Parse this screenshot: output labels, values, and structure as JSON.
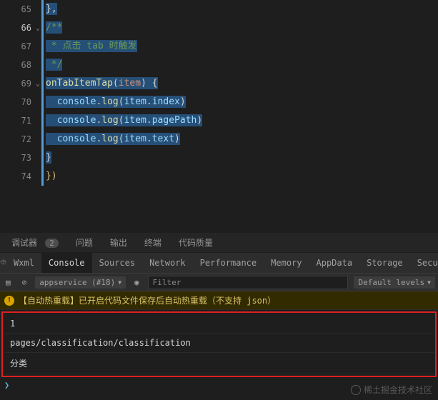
{
  "lines": [
    {
      "n": "65",
      "frag": [
        [
          "c-p",
          "},"
        ]
      ]
    },
    {
      "n": "66",
      "active": true,
      "fold": true,
      "frag": [
        [
          "c-c",
          "/**"
        ]
      ]
    },
    {
      "n": "67",
      "frag": [
        [
          "c-c",
          " * 点击 tab 时触发"
        ]
      ]
    },
    {
      "n": "68",
      "frag": [
        [
          "c-c",
          " */"
        ]
      ]
    },
    {
      "n": "69",
      "fold": true,
      "frag": [
        [
          "c-g",
          "onTabItemTap"
        ],
        [
          "c-p",
          "("
        ],
        [
          "c-o",
          "item"
        ],
        [
          "c-p",
          ") {"
        ]
      ]
    },
    {
      "n": "70",
      "frag": [
        [
          "c-b",
          "  console"
        ],
        [
          "c-p",
          "."
        ],
        [
          "c-g",
          "log"
        ],
        [
          "c-p",
          "("
        ],
        [
          "c-b",
          "item"
        ],
        [
          "c-p",
          "."
        ],
        [
          "c-b",
          "index"
        ],
        [
          "c-p",
          ")"
        ]
      ]
    },
    {
      "n": "71",
      "frag": [
        [
          "c-b",
          "  console"
        ],
        [
          "c-p",
          "."
        ],
        [
          "c-g",
          "log"
        ],
        [
          "c-p",
          "("
        ],
        [
          "c-b",
          "item"
        ],
        [
          "c-p",
          "."
        ],
        [
          "c-b",
          "pagePath"
        ],
        [
          "c-p",
          ")"
        ]
      ]
    },
    {
      "n": "72",
      "frag": [
        [
          "c-b",
          "  console"
        ],
        [
          "c-p",
          "."
        ],
        [
          "c-g",
          "log"
        ],
        [
          "c-p",
          "("
        ],
        [
          "c-b",
          "item"
        ],
        [
          "c-p",
          "."
        ],
        [
          "c-b",
          "text"
        ],
        [
          "c-p",
          ")"
        ]
      ]
    },
    {
      "n": "73",
      "frag": [
        [
          "c-p",
          "}"
        ]
      ]
    },
    {
      "n": "74",
      "nosel": true,
      "frag": [
        [
          "c-y",
          "})"
        ]
      ]
    }
  ],
  "panelTabs": {
    "debugger": "调试器",
    "badge": "2",
    "problems": "问题",
    "output": "输出",
    "terminal": "终端",
    "quality": "代码质量"
  },
  "devTabs": [
    "Wxml",
    "Console",
    "Sources",
    "Network",
    "Performance",
    "Memory",
    "AppData",
    "Storage",
    "Secu"
  ],
  "devActive": "Console",
  "toolbar": {
    "context": "appservice (#18)",
    "filter": "Filter",
    "levels": "Default levels"
  },
  "console": {
    "warn": "【自动热重载】已开启代码文件保存后自动热重载（不支持 json）",
    "rows": [
      "1",
      "pages/classification/classification",
      "分类"
    ]
  },
  "watermark": "稀土掘金技术社区"
}
